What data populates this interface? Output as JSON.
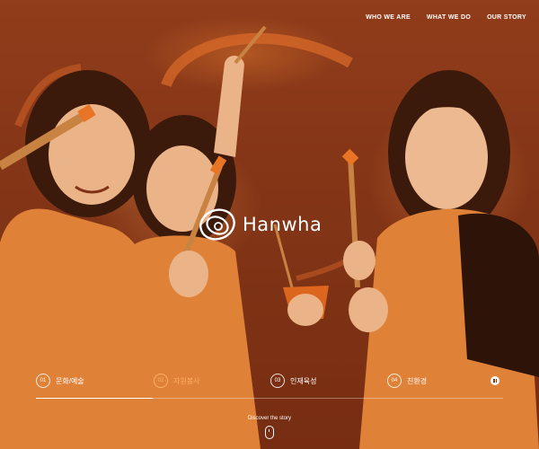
{
  "nav": {
    "items": [
      "WHO WE ARE",
      "WHAT WE DO",
      "OUR STORY"
    ]
  },
  "brand": {
    "wordmark": "Hanwha"
  },
  "tabs": [
    {
      "num": "01",
      "label": "문화/예술"
    },
    {
      "num": "02",
      "label": "자원봉사"
    },
    {
      "num": "03",
      "label": "인재육성"
    },
    {
      "num": "04",
      "label": "친환경"
    }
  ],
  "active_tab": 1,
  "slider_progress": 0.25,
  "footer": {
    "discover": "Discover the story"
  },
  "colors": {
    "accent": "#ffb066",
    "text": "#ffffff",
    "overlay": "#a5461c"
  },
  "icons": {
    "logo": "hanwha-logo-icon",
    "pause": "pause-icon",
    "scroll": "mouse-scroll-icon"
  }
}
